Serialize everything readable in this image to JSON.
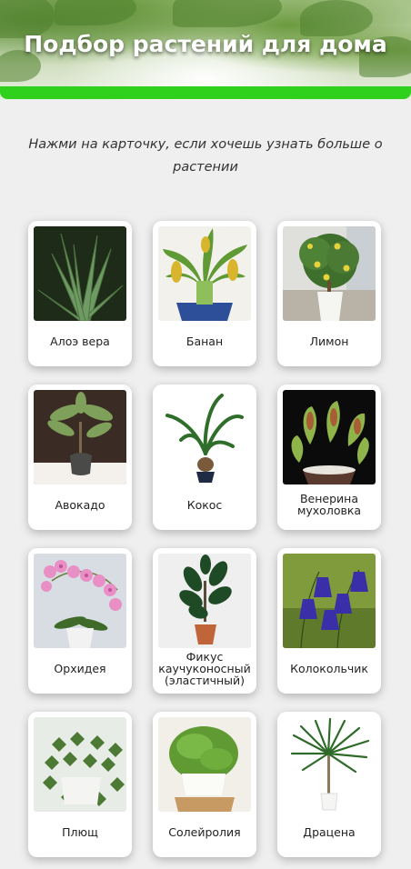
{
  "header": {
    "title": "Подбор растений для дома"
  },
  "subtitle": "Нажми на карточку, если хочешь узнать больше о растении",
  "plants": [
    {
      "name": "Алоэ вера",
      "icon": "aloe-vera-photo",
      "bg": "#1e2b18"
    },
    {
      "name": "Банан",
      "icon": "banana-plant-photo",
      "bg": "#f3f1ec"
    },
    {
      "name": "Лимон",
      "icon": "lemon-tree-photo",
      "bg": "#dfe0dc"
    },
    {
      "name": "Авокадо",
      "icon": "avocado-plant-photo",
      "bg": "#3a2c24"
    },
    {
      "name": "Кокос",
      "icon": "coconut-palm-photo",
      "bg": "#ffffff"
    },
    {
      "name": "Венерина мухоловка",
      "icon": "venus-flytrap-photo",
      "bg": "#0b0b0b"
    },
    {
      "name": "Орхидея",
      "icon": "orchid-photo",
      "bg": "#d8dde3"
    },
    {
      "name": "Фикус каучуконосный (эластичный)",
      "icon": "ficus-elastica-photo",
      "bg": "#efefef"
    },
    {
      "name": "Колокольчик",
      "icon": "bellflower-photo",
      "bg": "#7f9b3c"
    },
    {
      "name": "Плющ",
      "icon": "ivy-photo",
      "bg": "#e8ece6"
    },
    {
      "name": "Солейролия",
      "icon": "soleirolia-photo",
      "bg": "#f2efe8"
    },
    {
      "name": "Драцена",
      "icon": "dracaena-photo",
      "bg": "#ffffff"
    }
  ]
}
